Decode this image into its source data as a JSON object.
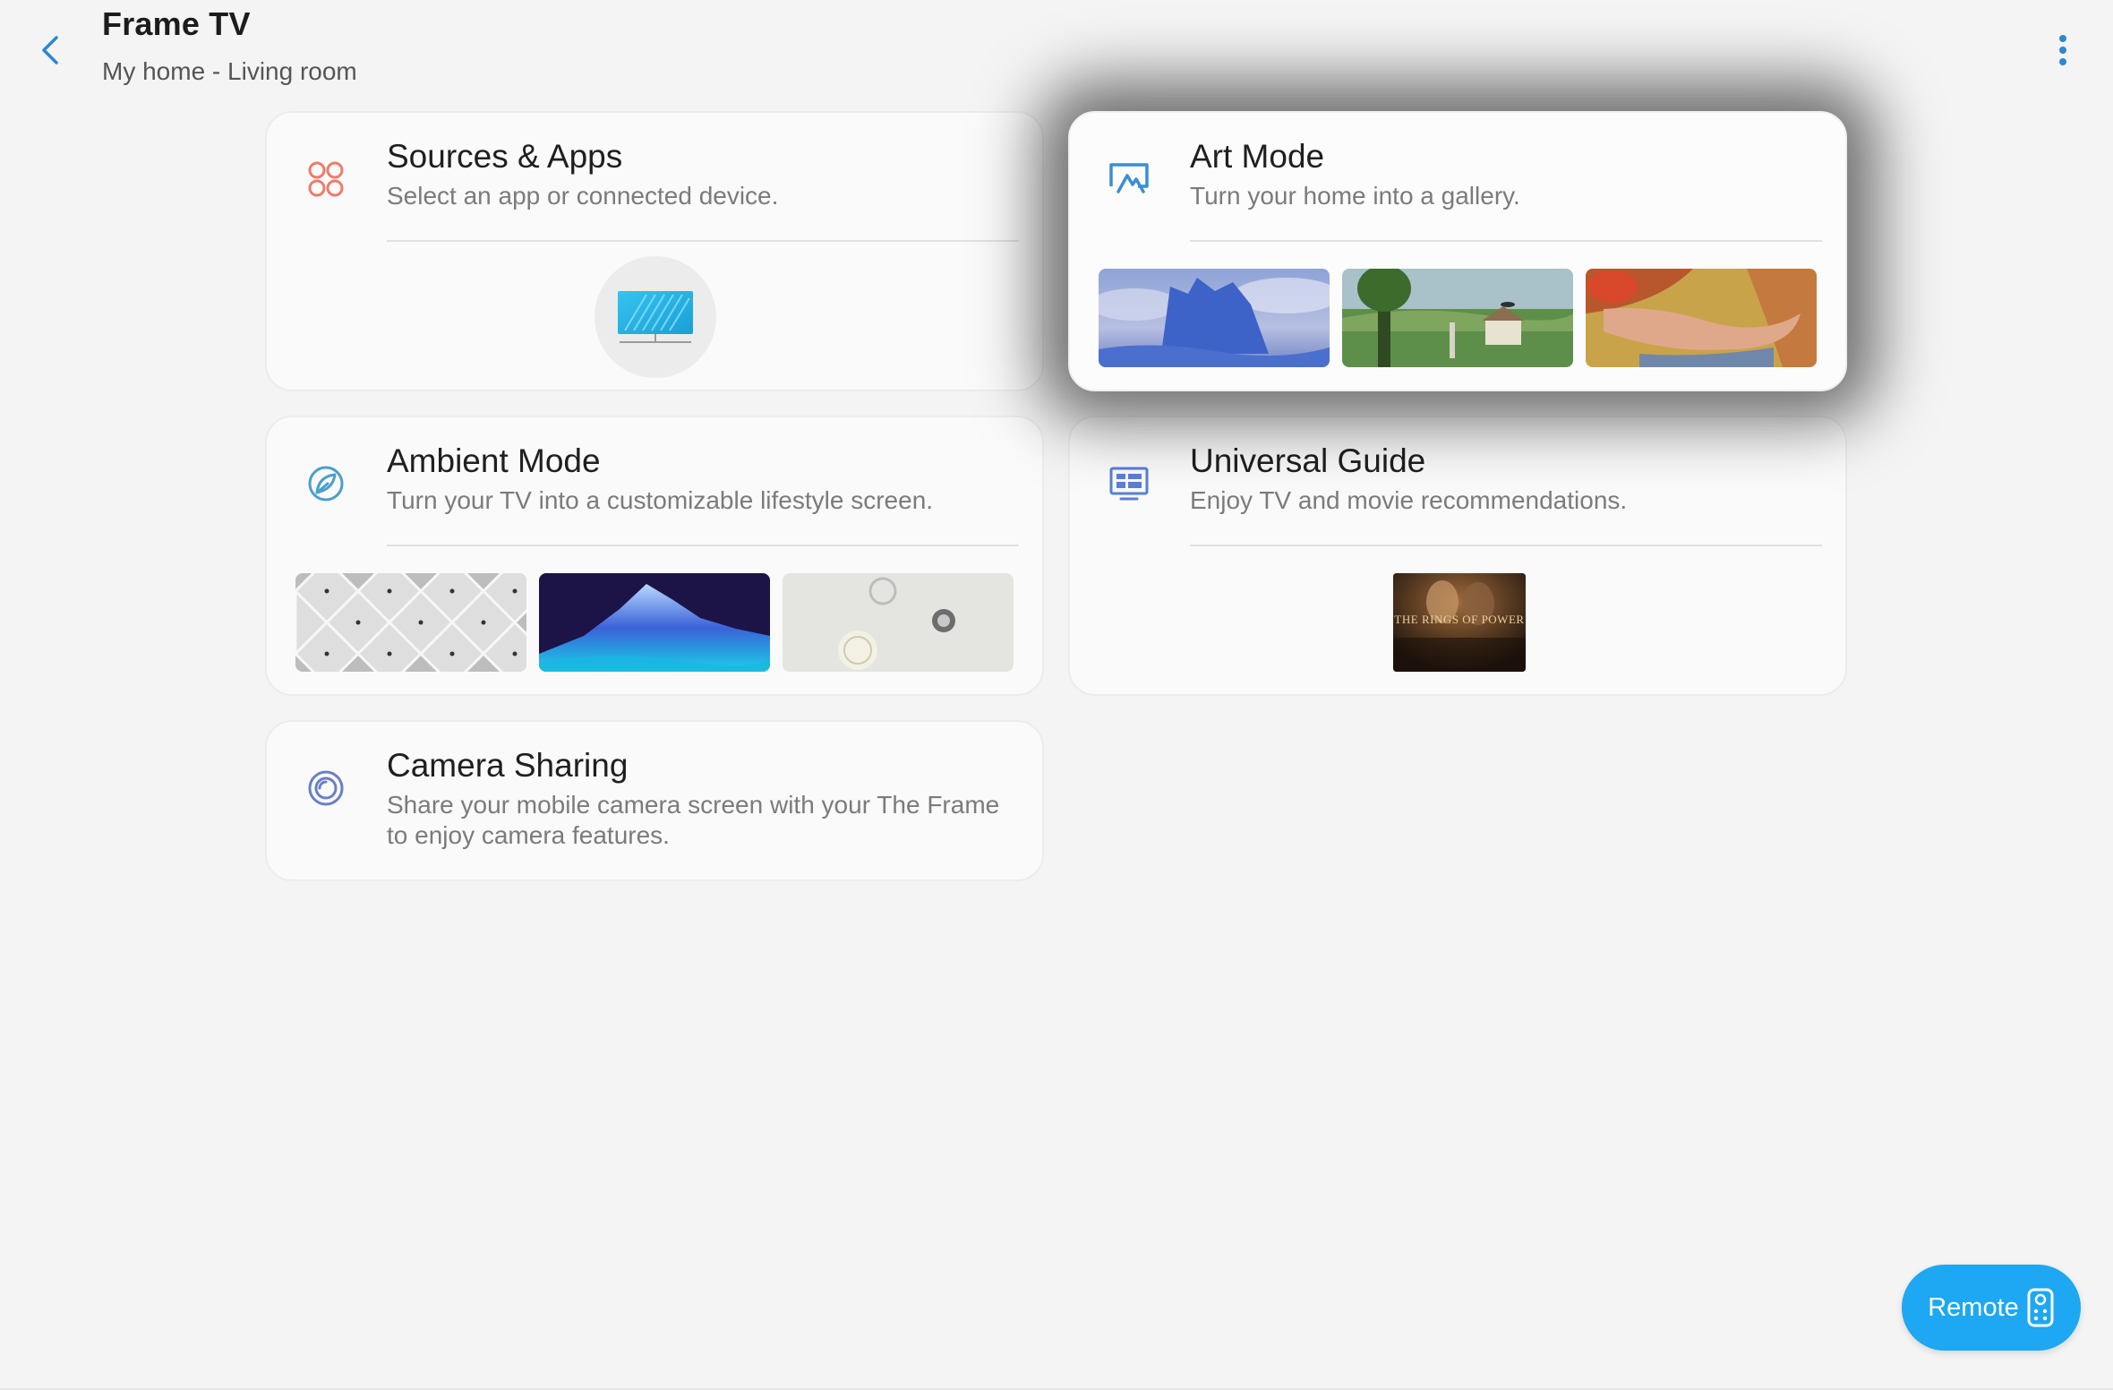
{
  "header": {
    "title": "Frame TV",
    "subtitle": "My home - Living room",
    "back_icon": "chevron-left-icon",
    "more_icon": "more-vertical-icon"
  },
  "cards": {
    "sources": {
      "title": "Sources & Apps",
      "description": "Select an app or connected device.",
      "icon": "apps-grid-icon",
      "icon_color": "#ef7b6b",
      "preview_icon": "tv-device-icon"
    },
    "art_mode": {
      "title": "Art Mode",
      "description": "Turn your home into a gallery.",
      "icon": "art-mode-icon",
      "icon_color": "#4a90c8",
      "thumbnails": [
        "blue-ship-painting",
        "green-landscape-painting",
        "reclining-figure-painting"
      ]
    },
    "ambient": {
      "title": "Ambient Mode",
      "description": "Turn your TV into a customizable lifestyle screen.",
      "icon": "ambient-leaf-icon",
      "icon_color": "#4a9fcb",
      "thumbnails": [
        "diamond-pattern",
        "purple-mountain",
        "circles-on-grey"
      ]
    },
    "guide": {
      "title": "Universal Guide",
      "description": "Enjoy TV and movie recommendations.",
      "icon": "universal-guide-icon",
      "icon_color": "#5a7fd6",
      "poster_text": "THE RINGS OF POWER"
    },
    "camera": {
      "title": "Camera Sharing",
      "description": "Share your mobile camera screen with your The Frame to enjoy camera features.",
      "icon": "camera-sharing-icon",
      "icon_color": "#6a7fc8"
    }
  },
  "remote": {
    "label": "Remote",
    "icon": "remote-control-icon",
    "color": "#1ea7f2"
  }
}
